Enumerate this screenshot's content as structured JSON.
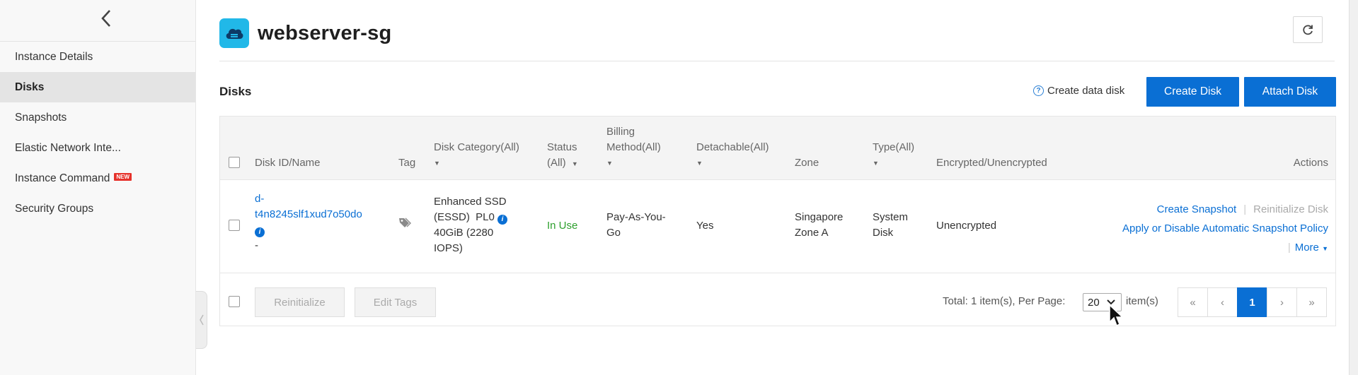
{
  "sidebar": {
    "items": [
      {
        "label": "Instance Details"
      },
      {
        "label": "Disks"
      },
      {
        "label": "Snapshots"
      },
      {
        "label": "Elastic Network Inte..."
      },
      {
        "label": "Instance Command",
        "badge": "NEW"
      },
      {
        "label": "Security Groups"
      }
    ]
  },
  "header": {
    "title": "webserver-sg"
  },
  "section": {
    "title": "Disks",
    "help_link": "Create data disk",
    "create_button": "Create Disk",
    "attach_button": "Attach Disk"
  },
  "table": {
    "columns": {
      "disk_id": "Disk ID/Name",
      "tag": "Tag",
      "category": "Disk Category(All)",
      "status_line1": "Status",
      "status_line2": "(All)",
      "billing_line1": "Billing",
      "billing_line2": "Method(All)",
      "detachable": "Detachable(All)",
      "zone": "Zone",
      "type": "Type(All)",
      "encrypted": "Encrypted/Unencrypted",
      "actions": "Actions"
    },
    "rows": [
      {
        "disk_id_line1": "d-",
        "disk_id_line2": "t4n8245slf1xud7o50do",
        "disk_name": "-",
        "category_line1": "Enhanced SSD",
        "category_line2": "(ESSD)  PL0",
        "category_line3": "40GiB (2280",
        "category_line4": "IOPS)",
        "status": "In Use",
        "billing_line1": "Pay-As-You-",
        "billing_line2": "Go",
        "detachable": "Yes",
        "zone_line1": "Singapore",
        "zone_line2": "Zone A",
        "type_line1": "System",
        "type_line2": "Disk",
        "encrypted": "Unencrypted",
        "action_snapshot": "Create Snapshot",
        "action_reinit": "Reinitialize Disk",
        "action_policy": "Apply or Disable Automatic Snapshot Policy",
        "action_more": "More"
      }
    ]
  },
  "footer": {
    "reinitialize_button": "Reinitialize",
    "edit_tags_button": "Edit Tags",
    "total_text": "Total: 1 item(s), Per Page:",
    "per_page": "20",
    "items_suffix": "item(s)",
    "pages": {
      "first": "«",
      "prev": "‹",
      "current": "1",
      "next": "›",
      "last": "»"
    }
  },
  "colors": {
    "primary": "#0a6fd4",
    "status_in_use": "#2ea02e",
    "app_icon": "#21b8e8",
    "badge_new": "#e6322b"
  }
}
